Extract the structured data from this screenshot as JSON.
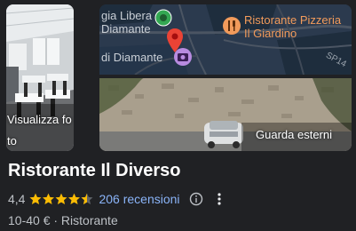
{
  "photos": {
    "label": "Visualizza foto"
  },
  "map": {
    "labels": {
      "top_left": "gia Libera",
      "left_mid": "Diamante",
      "bottom_left": "di Diamante",
      "restaurant_line1": "Ristorante Pizzeria",
      "restaurant_line2": "Il Giardino",
      "road": "SP14"
    },
    "colors": {
      "water": "#2b3a4e",
      "land": "#1d2c3c",
      "road": "#4b5563",
      "pin": "#ea4335",
      "green_marker": "#34a853",
      "purple_marker": "#b88be0",
      "orange_marker": "#f29b5b"
    },
    "icons": [
      "restaurant-icon",
      "map-pin-icon",
      "camera-icon",
      "park-marker-icon"
    ]
  },
  "streetview": {
    "label": "Guarda esterni"
  },
  "place": {
    "name": "Ristorante Il Diverso",
    "rating": "4,4",
    "rating_fraction": 0.88,
    "reviews_label": "206 recensioni",
    "price_category": "10-40 € · Ristorante"
  },
  "colors": {
    "background": "#202124",
    "star": "#fbbc04",
    "link": "#8ab4f8",
    "muted_text": "#bdc1c6"
  }
}
